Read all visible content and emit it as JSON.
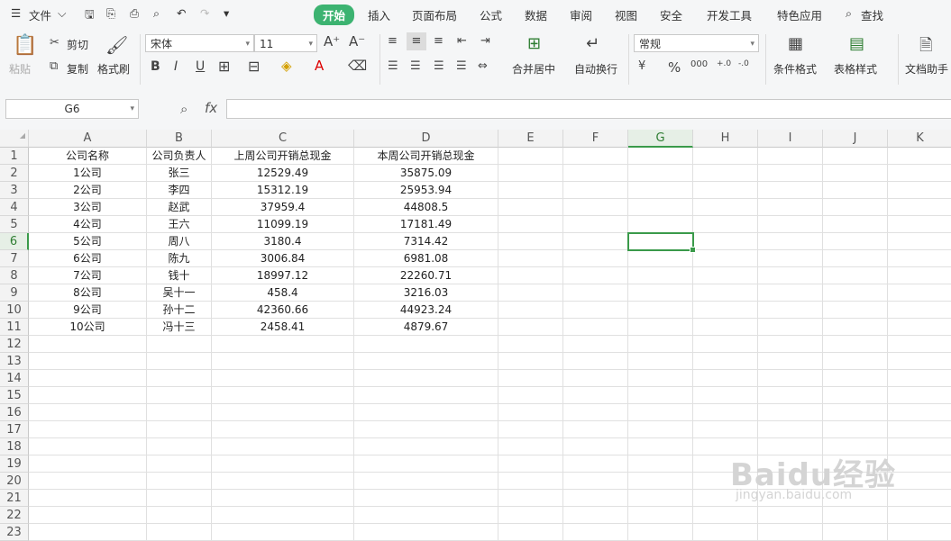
{
  "menu": {
    "file_label": "文件",
    "tabs": [
      "开始",
      "插入",
      "页面布局",
      "公式",
      "数据",
      "审阅",
      "视图",
      "安全",
      "开发工具",
      "特色应用"
    ],
    "search_label": "查找"
  },
  "ribbon": {
    "paste": "粘贴",
    "cut": "剪切",
    "copy": "复制",
    "format_painter": "格式刷",
    "font_name": "宋体",
    "font_size": "11",
    "merge_center": "合并居中",
    "wrap_text": "自动换行",
    "number_format": "常规",
    "conditional_format": "条件格式",
    "table_style": "表格样式",
    "doc_helper": "文档助手"
  },
  "formula_bar": {
    "name_box": "G6",
    "fx": "fx",
    "content": ""
  },
  "sheet": {
    "columns": [
      "A",
      "B",
      "C",
      "D",
      "E",
      "F",
      "G",
      "H",
      "I",
      "J",
      "K"
    ],
    "selected_cell": "G6",
    "headers": [
      "公司名称",
      "公司负责人",
      "上周公司开销总现金",
      "本周公司开销总现金"
    ],
    "rows": [
      [
        "1公司",
        "张三",
        "12529.49",
        "35875.09"
      ],
      [
        "2公司",
        "李四",
        "15312.19",
        "25953.94"
      ],
      [
        "3公司",
        "赵武",
        "37959.4",
        "44808.5"
      ],
      [
        "4公司",
        "王六",
        "11099.19",
        "17181.49"
      ],
      [
        "5公司",
        "周八",
        "3180.4",
        "7314.42"
      ],
      [
        "6公司",
        "陈九",
        "3006.84",
        "6981.08"
      ],
      [
        "7公司",
        "钱十",
        "18997.12",
        "22260.71"
      ],
      [
        "8公司",
        "吴十一",
        "458.4",
        "3216.03"
      ],
      [
        "9公司",
        "孙十二",
        "42360.66",
        "44923.24"
      ],
      [
        "10公司",
        "冯十三",
        "2458.41",
        "4879.67"
      ]
    ],
    "row_count": 23
  },
  "watermark": {
    "main": "Baidu经验",
    "sub": "jingyan.baidu.com"
  }
}
